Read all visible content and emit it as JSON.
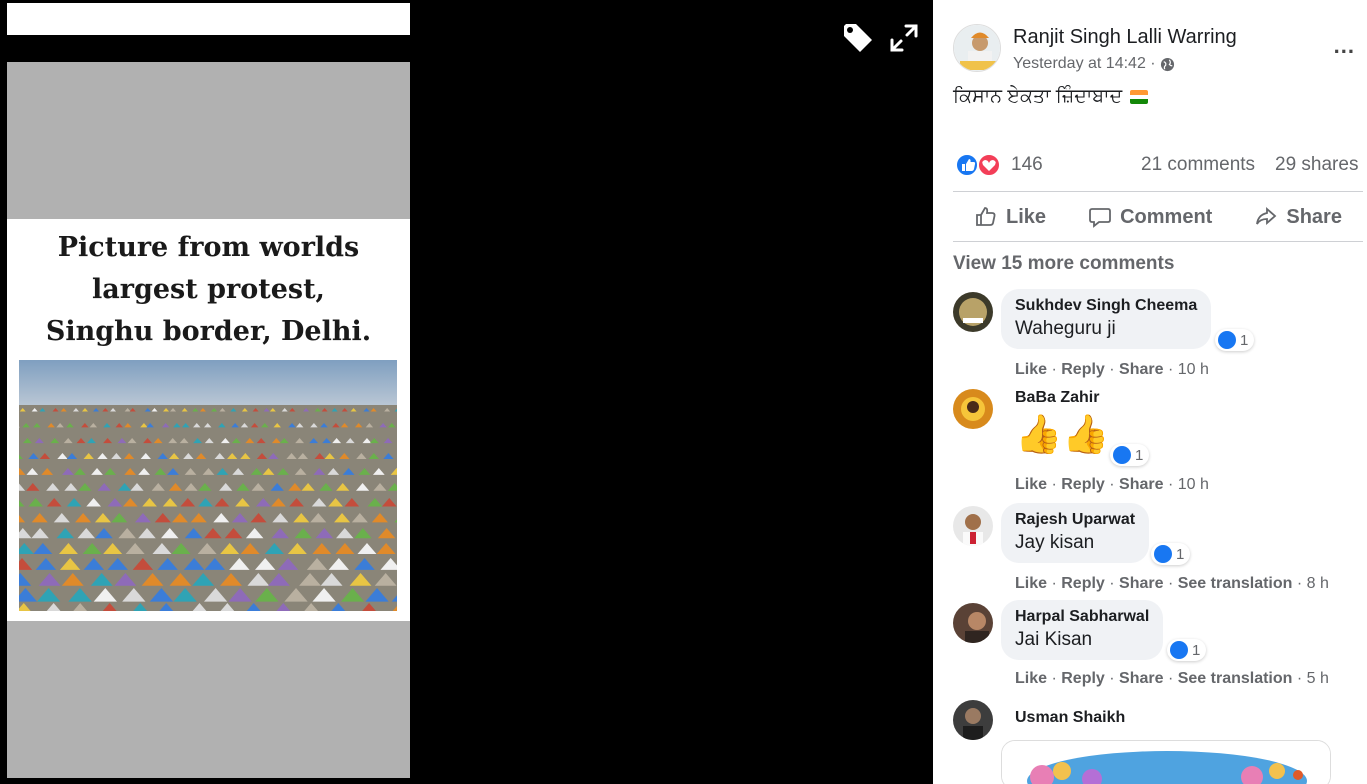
{
  "viewer": {
    "card_headline_lines": [
      "Picture from worlds",
      "largest protest,",
      "Singhu border, Delhi."
    ],
    "tag_icon": "tag-icon",
    "expand_icon": "expand-icon"
  },
  "post": {
    "author": "Ranjit Singh Lalli Warring",
    "timestamp": "Yesterday at 14:42 ·",
    "privacy_icon": "globe-icon",
    "text": "ਕਿਸਾਨ ਏਕਤਾ ਜ਼ਿੰਦਾਬਾਦ",
    "more_icon": "more-icon",
    "more_label": "..."
  },
  "stats": {
    "reactions": "146",
    "comments": "21 comments",
    "shares": "29 shares"
  },
  "actions": {
    "like": "Like",
    "comment": "Comment",
    "share": "Share"
  },
  "view_more": "View 15 more comments",
  "comments": [
    {
      "name": "Sukhdev Singh Cheema",
      "text": "Waheguru ji",
      "reactions": "1",
      "links": [
        "Like",
        "Reply",
        "Share"
      ],
      "time": "10 h"
    },
    {
      "name": "BaBa Zahir",
      "text": "👍👍",
      "reactions": "1",
      "links": [
        "Like",
        "Reply",
        "Share"
      ],
      "time": "10 h"
    },
    {
      "name": "Rajesh Uparwat",
      "text": "Jay kisan",
      "reactions": "1",
      "links": [
        "Like",
        "Reply",
        "Share",
        "See translation"
      ],
      "time": "8 h"
    },
    {
      "name": "Harpal Sabharwal",
      "text": "Jai Kisan",
      "reactions": "1",
      "links": [
        "Like",
        "Reply",
        "Share",
        "See translation"
      ],
      "time": "5 h"
    },
    {
      "name": "Usman Shaikh"
    }
  ],
  "colors": {
    "accent": "#1877f2",
    "love": "#f33e58",
    "muted": "#65676b",
    "bubble": "#f0f2f5"
  }
}
